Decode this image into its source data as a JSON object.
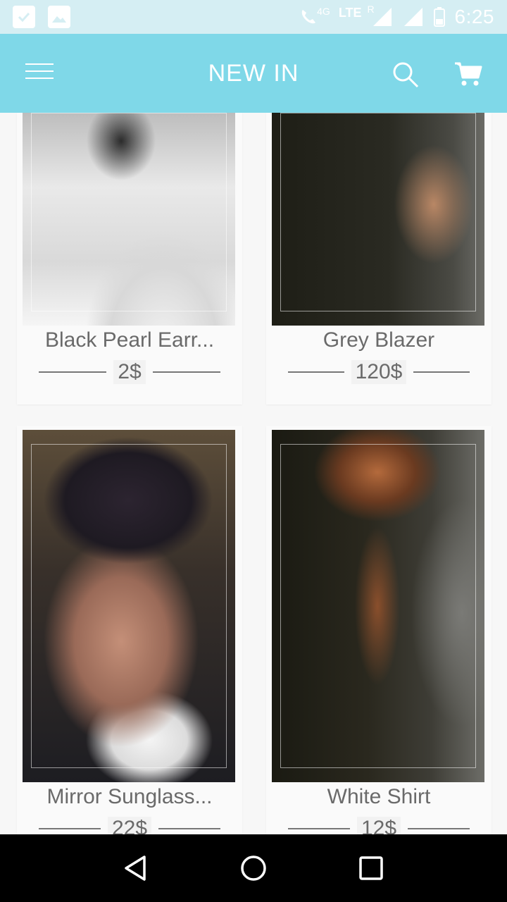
{
  "status_bar": {
    "network_label": "4G",
    "lte_label": "LTE",
    "roaming_label": "R",
    "time": "6:25"
  },
  "app_bar": {
    "title": "NEW IN",
    "menu_icon": "hamburger-menu-icon",
    "search_icon": "search-icon",
    "cart_icon": "cart-icon"
  },
  "products": [
    {
      "name": "Black Pearl Earr...",
      "price": "2$"
    },
    {
      "name": "Grey Blazer",
      "price": "120$"
    },
    {
      "name": "Mirror Sunglass...",
      "price": "22$"
    },
    {
      "name": "White Shirt",
      "price": "12$"
    }
  ],
  "nav_bar": {
    "back_icon": "back-triangle-icon",
    "home_icon": "home-circle-icon",
    "recents_icon": "recents-square-icon"
  },
  "colors": {
    "app_bar": "#7fd8e8",
    "status_bar": "#d5eef3",
    "text": "#6a6a6a"
  }
}
